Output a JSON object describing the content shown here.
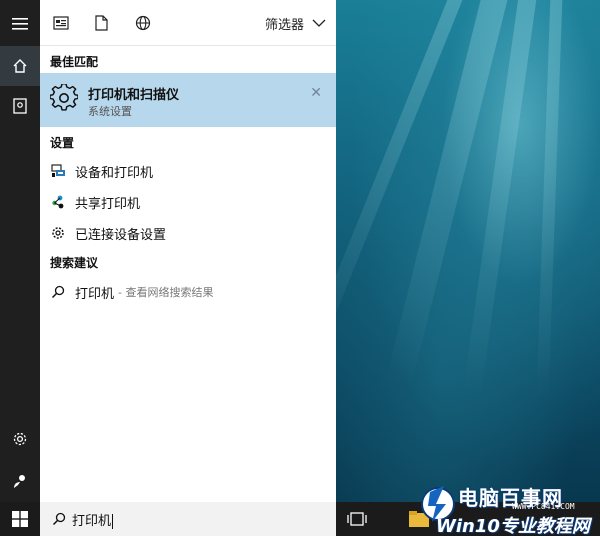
{
  "filter_bar": {
    "icons": [
      "apps-icon",
      "document-icon",
      "web-globe-icon"
    ],
    "dropdown_label": "筛选器"
  },
  "best_match": {
    "heading": "最佳匹配",
    "title": "打印机和扫描仪",
    "subtitle": "系统设置",
    "icon": "gear-icon",
    "close": "✕"
  },
  "settings": {
    "heading": "设置",
    "items": [
      {
        "label": "设备和打印机",
        "icon": "devices-printer-icon"
      },
      {
        "label": "共享打印机",
        "icon": "share-network-icon"
      },
      {
        "label": "已连接设备设置",
        "icon": "gear-icon"
      }
    ]
  },
  "suggestions": {
    "heading": "搜索建议",
    "items": [
      {
        "label": "打印机",
        "hint": "- 查看网络搜索结果",
        "icon": "search-icon"
      }
    ]
  },
  "search": {
    "query": "打印机"
  },
  "rail": {
    "items": [
      "hamburger-menu-icon",
      "home-icon",
      "notebook-icon",
      "settings-gear-icon",
      "feedback-icon"
    ]
  },
  "watermark": {
    "top": "电脑百事网",
    "url": "WWW.PC841.COM",
    "bottom": "Win10专业教程网"
  },
  "colors": {
    "highlight": "#b7d7ed",
    "rail": "#1f1f1f",
    "taskbar": "#1b1b1b"
  }
}
